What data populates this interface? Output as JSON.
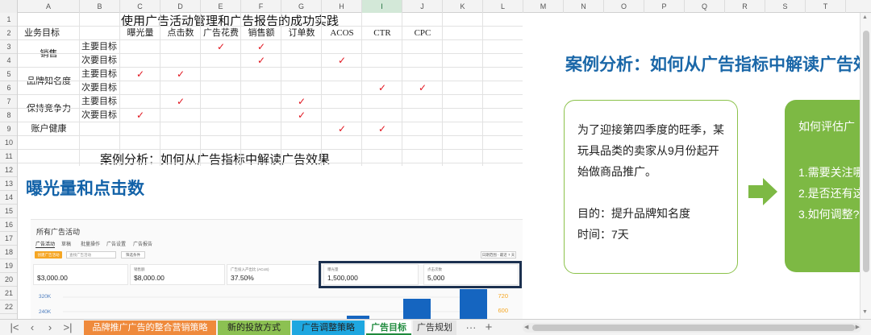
{
  "columns": [
    "A",
    "B",
    "C",
    "D",
    "E",
    "F",
    "G",
    "H",
    "I",
    "J",
    "K",
    "L",
    "M",
    "N",
    "O",
    "P",
    "Q",
    "R",
    "S",
    "T"
  ],
  "selected_column": "I",
  "rows": [
    "1",
    "2",
    "3",
    "4",
    "5",
    "6",
    "7",
    "8",
    "9",
    "10",
    "11",
    "12",
    "13",
    "14",
    "15",
    "16",
    "17",
    "18",
    "19",
    "20",
    "21",
    "22"
  ],
  "sheet": {
    "title": "使用广告活动管理和广告报告的成功实践",
    "headers": [
      "业务目标",
      "曝光量",
      "点击数",
      "广告花费",
      "销售额",
      "订单数",
      "ACOS",
      "CTR",
      "CPC"
    ],
    "groups": [
      {
        "name": "销售",
        "items": [
          {
            "label": "主要目标",
            "checks": [
              false,
              false,
              true,
              true,
              false,
              false,
              false,
              false
            ]
          },
          {
            "label": "次要目标",
            "checks": [
              false,
              false,
              false,
              true,
              false,
              true,
              false,
              false
            ]
          }
        ]
      },
      {
        "name": "品牌知名度",
        "items": [
          {
            "label": "主要目标",
            "checks": [
              true,
              true,
              false,
              false,
              false,
              false,
              false,
              false
            ]
          },
          {
            "label": "次要目标",
            "checks": [
              false,
              false,
              false,
              false,
              false,
              false,
              true,
              true
            ]
          }
        ]
      },
      {
        "name": "保持竞争力",
        "items": [
          {
            "label": "主要目标",
            "checks": [
              false,
              true,
              false,
              false,
              true,
              false,
              false,
              false
            ]
          },
          {
            "label": "次要目标",
            "checks": [
              true,
              false,
              false,
              false,
              true,
              false,
              false,
              false
            ]
          }
        ]
      },
      {
        "name": "账户健康",
        "items": [
          {
            "label": "",
            "checks": [
              false,
              false,
              false,
              false,
              false,
              true,
              true,
              false
            ]
          }
        ]
      }
    ],
    "check_glyph": "✓",
    "subtitle": "案例分析：如何从广告指标中解读广告效果"
  },
  "left_image": {
    "title": "曝光量和点击数",
    "screenshot": {
      "heading": "所有广告活动",
      "tabs": [
        "广告活动",
        "草稿",
        "批量操作",
        "广告设置",
        "广告报告"
      ],
      "create_button": "创建广告活动",
      "search_placeholder": "查找广告活动",
      "filter_button": "筛选条件",
      "date_range": "日期范围 - 最近 7 天",
      "metrics": [
        {
          "label": "",
          "value": "$3,000.00"
        },
        {
          "label": "销售额",
          "value": "$8,000.00"
        },
        {
          "label": "广告投入产出比 (ACoS)",
          "value": "37.50%"
        },
        {
          "label": "曝光量",
          "value": "1,500,000"
        },
        {
          "label": "点击次数",
          "value": "5,000"
        }
      ],
      "axis_left": [
        "320K",
        "240K"
      ],
      "axis_right": [
        "720",
        "600"
      ]
    }
  },
  "right_image": {
    "title": "案例分析：如何从广告指标中解读广告效",
    "card1_lines": [
      "为了迎接第四季度的旺季，某",
      "玩具品类的卖家从9月份起开",
      "始做商品推广。",
      "",
      "目的：提升品牌知名度",
      "时间：7天"
    ],
    "card2_lines": [
      "如何评估广",
      "",
      "1.需要关注哪",
      "2.是否还有这",
      "3.如何调整?"
    ]
  },
  "tabs": [
    {
      "label": "品牌推广广告的整合营销策略",
      "bg": "#ef8a3c",
      "fg": "#ffffff",
      "active": false
    },
    {
      "label": "新的投放方式",
      "bg": "#8cc152",
      "fg": "#222222",
      "active": false
    },
    {
      "label": "广告调整策略",
      "bg": "#1ea7e0",
      "fg": "#222222",
      "active": false
    },
    {
      "label": "广告目标",
      "bg": "#ffffff",
      "fg": "#1e8a3c",
      "active": true
    },
    {
      "label": "广告规划",
      "bg": "#e6e6e6",
      "fg": "#333333",
      "active": false
    }
  ],
  "tab_more": "···",
  "tab_add": "+",
  "colors": {
    "accent": "#1e8a3c",
    "check": "#e0141e",
    "title_blue": "#1262a8",
    "card_green": "#7db944"
  }
}
